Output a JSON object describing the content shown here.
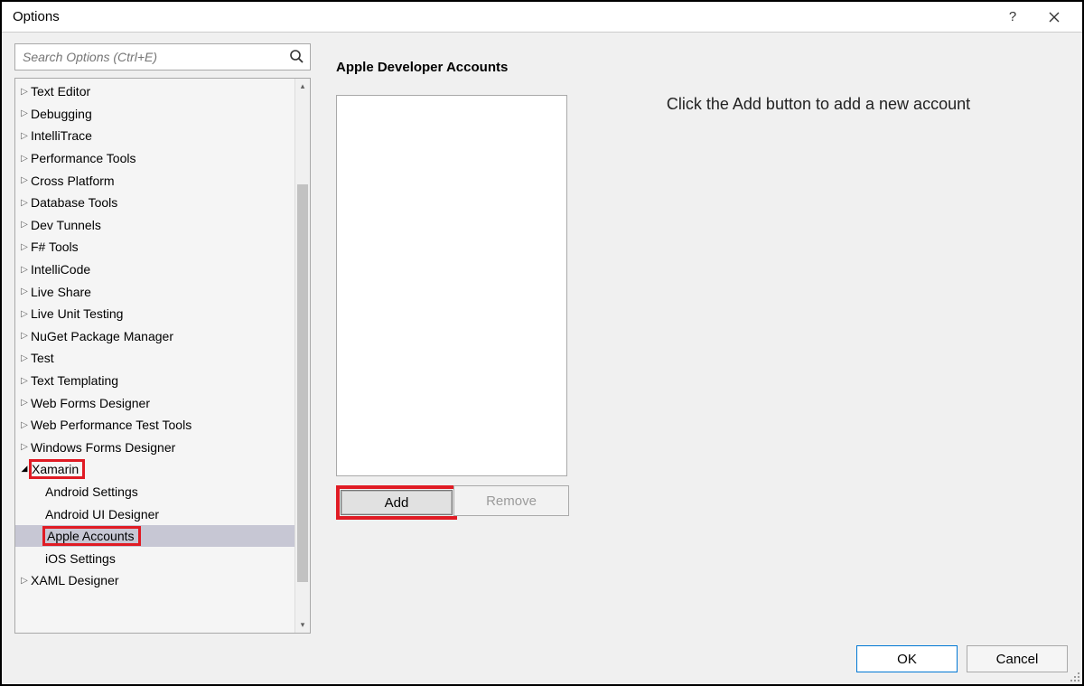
{
  "window": {
    "title": "Options"
  },
  "search": {
    "placeholder": "Search Options (Ctrl+E)"
  },
  "tree": {
    "items": [
      {
        "name": "text-editor",
        "label": "Text Editor",
        "expanded": false
      },
      {
        "name": "debugging",
        "label": "Debugging",
        "expanded": false
      },
      {
        "name": "intellitrace",
        "label": "IntelliTrace",
        "expanded": false
      },
      {
        "name": "performance-tools",
        "label": "Performance Tools",
        "expanded": false
      },
      {
        "name": "cross-platform",
        "label": "Cross Platform",
        "expanded": false
      },
      {
        "name": "database-tools",
        "label": "Database Tools",
        "expanded": false
      },
      {
        "name": "dev-tunnels",
        "label": "Dev Tunnels",
        "expanded": false
      },
      {
        "name": "fsharp-tools",
        "label": "F# Tools",
        "expanded": false
      },
      {
        "name": "intellicode",
        "label": "IntelliCode",
        "expanded": false
      },
      {
        "name": "live-share",
        "label": "Live Share",
        "expanded": false
      },
      {
        "name": "live-unit-testing",
        "label": "Live Unit Testing",
        "expanded": false
      },
      {
        "name": "nuget-package-manager",
        "label": "NuGet Package Manager",
        "expanded": false
      },
      {
        "name": "test",
        "label": "Test",
        "expanded": false
      },
      {
        "name": "text-templating",
        "label": "Text Templating",
        "expanded": false
      },
      {
        "name": "web-forms-designer",
        "label": "Web Forms Designer",
        "expanded": false
      },
      {
        "name": "web-performance-test-tools",
        "label": "Web Performance Test Tools",
        "expanded": false
      },
      {
        "name": "windows-forms-designer",
        "label": "Windows Forms Designer",
        "expanded": false
      },
      {
        "name": "xamarin",
        "label": "Xamarin",
        "expanded": true,
        "highlight": true,
        "children": [
          {
            "name": "android-settings",
            "label": "Android Settings"
          },
          {
            "name": "android-ui-designer",
            "label": "Android UI Designer"
          },
          {
            "name": "apple-accounts",
            "label": "Apple Accounts",
            "selected": true,
            "highlight": true
          },
          {
            "name": "ios-settings",
            "label": "iOS Settings"
          }
        ]
      },
      {
        "name": "xaml-designer",
        "label": "XAML Designer",
        "expanded": false
      }
    ]
  },
  "panel": {
    "title": "Apple Developer Accounts",
    "hint": "Click the Add button to add a new account",
    "add_label": "Add",
    "remove_label": "Remove"
  },
  "footer": {
    "ok_label": "OK",
    "cancel_label": "Cancel"
  }
}
